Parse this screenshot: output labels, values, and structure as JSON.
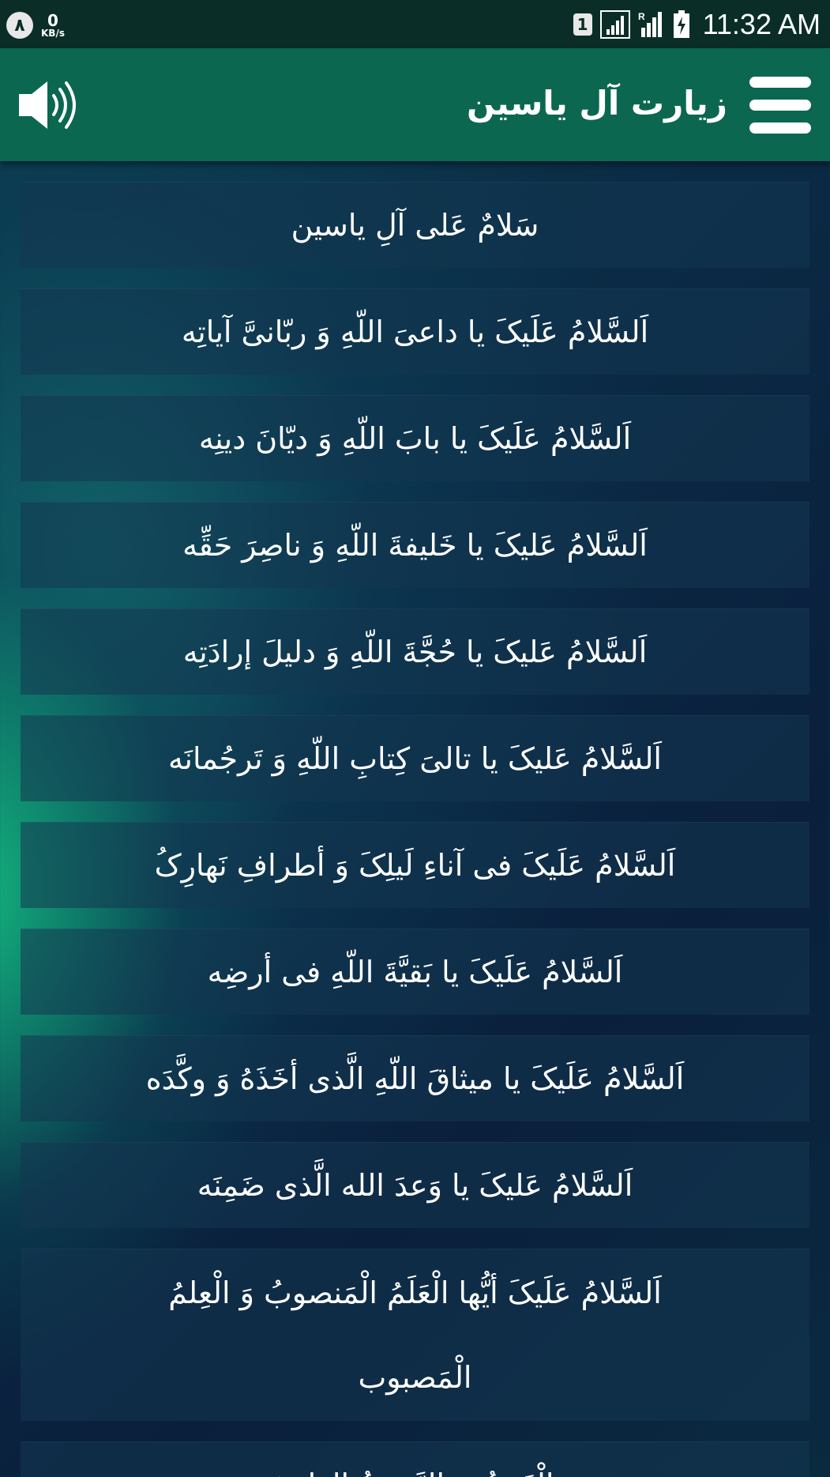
{
  "status_bar": {
    "notification_badge": "٨",
    "speed_value": "0",
    "speed_unit": "KB/s",
    "sim_badge": "1",
    "time": "11:32 AM"
  },
  "app_bar": {
    "title": "زیارت آل یاسین",
    "menu_icon": "hamburger-menu-icon",
    "sound_icon": "speaker-volume-icon"
  },
  "items": [
    {
      "text": "سَلامٌ عَلی آلِ یاسین"
    },
    {
      "text": "اَلسَّلامُ عَلَیکَ یا داعیَ اللّهِ وَ ربّانیَّ آیاتِه"
    },
    {
      "text": "اَلسَّلامُ عَلَیکَ یا بابَ اللّهِ وَ دیّانَ دینِه"
    },
    {
      "text": "اَلسَّلامُ عَلیکَ یا خَلیفةَ اللّهِ وَ ناصِرَ حَقِّه"
    },
    {
      "text": "اَلسَّلامُ عَلیکَ یا حُجَّةَ اللّهِ وَ دلیلَ إرادَتِه"
    },
    {
      "text": "اَلسَّلامُ عَلیکَ یا تالیَ کِتابِ اللّهِ وَ تَرجُمانَه"
    },
    {
      "text": "اَلسَّلامُ عَلَیکَ فی آناءِ لَیلِکَ وَ أطرافِ نَهارِکُ"
    },
    {
      "text": "اَلسَّلامُ عَلَیکَ یا بَقیَّةَ اللّهِ فی أرضِه"
    },
    {
      "text": "اَلسَّلامُ عَلَیکَ یا میثاقَ اللّهِ الَّذی أخَذَهُ وَ وکَّدَه"
    },
    {
      "text": "اَلسَّلامُ عَلیکَ یا وَعدَ الله الَّذی ضَمِنَه"
    },
    {
      "text": "اَلسَّلامُ عَلَیکَ أیُّها الْعَلَمُ الْمَنصوبُ وَ الْعِلمُ الْمَصبوب"
    },
    {
      "text": "وَ الْغَوثُ وَ الرَّحمَةُ الواسِعَة"
    }
  ]
}
